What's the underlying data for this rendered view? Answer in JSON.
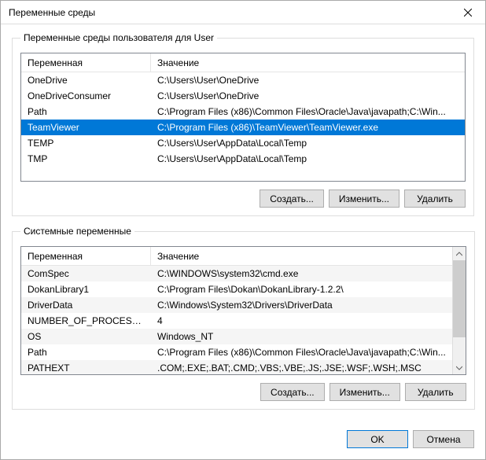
{
  "window": {
    "title": "Переменные среды"
  },
  "userVars": {
    "legend": "Переменные среды пользователя для User",
    "columns": {
      "name": "Переменная",
      "value": "Значение"
    },
    "rows": [
      {
        "name": "OneDrive",
        "value": "C:\\Users\\User\\OneDrive",
        "selected": false
      },
      {
        "name": "OneDriveConsumer",
        "value": "C:\\Users\\User\\OneDrive",
        "selected": false
      },
      {
        "name": "Path",
        "value": "C:\\Program Files (x86)\\Common Files\\Oracle\\Java\\javapath;C:\\Win...",
        "selected": false
      },
      {
        "name": "TeamViewer",
        "value": "C:\\Program Files (x86)\\TeamViewer\\TeamViewer.exe",
        "selected": true
      },
      {
        "name": "TEMP",
        "value": "C:\\Users\\User\\AppData\\Local\\Temp",
        "selected": false
      },
      {
        "name": "TMP",
        "value": "C:\\Users\\User\\AppData\\Local\\Temp",
        "selected": false
      }
    ],
    "buttons": {
      "new": "Создать...",
      "edit": "Изменить...",
      "delete": "Удалить"
    }
  },
  "systemVars": {
    "legend": "Системные переменные",
    "columns": {
      "name": "Переменная",
      "value": "Значение"
    },
    "rows": [
      {
        "name": "ComSpec",
        "value": "C:\\WINDOWS\\system32\\cmd.exe"
      },
      {
        "name": "DokanLibrary1",
        "value": "C:\\Program Files\\Dokan\\DokanLibrary-1.2.2\\"
      },
      {
        "name": "DriverData",
        "value": "C:\\Windows\\System32\\Drivers\\DriverData"
      },
      {
        "name": "NUMBER_OF_PROCESSORS",
        "value": "4"
      },
      {
        "name": "OS",
        "value": "Windows_NT"
      },
      {
        "name": "Path",
        "value": "C:\\Program Files (x86)\\Common Files\\Oracle\\Java\\javapath;C:\\Win..."
      },
      {
        "name": "PATHEXT",
        "value": ".COM;.EXE;.BAT;.CMD;.VBS;.VBE;.JS;.JSE;.WSF;.WSH;.MSC"
      }
    ],
    "buttons": {
      "new": "Создать...",
      "edit": "Изменить...",
      "delete": "Удалить"
    }
  },
  "footer": {
    "ok": "OK",
    "cancel": "Отмена"
  }
}
